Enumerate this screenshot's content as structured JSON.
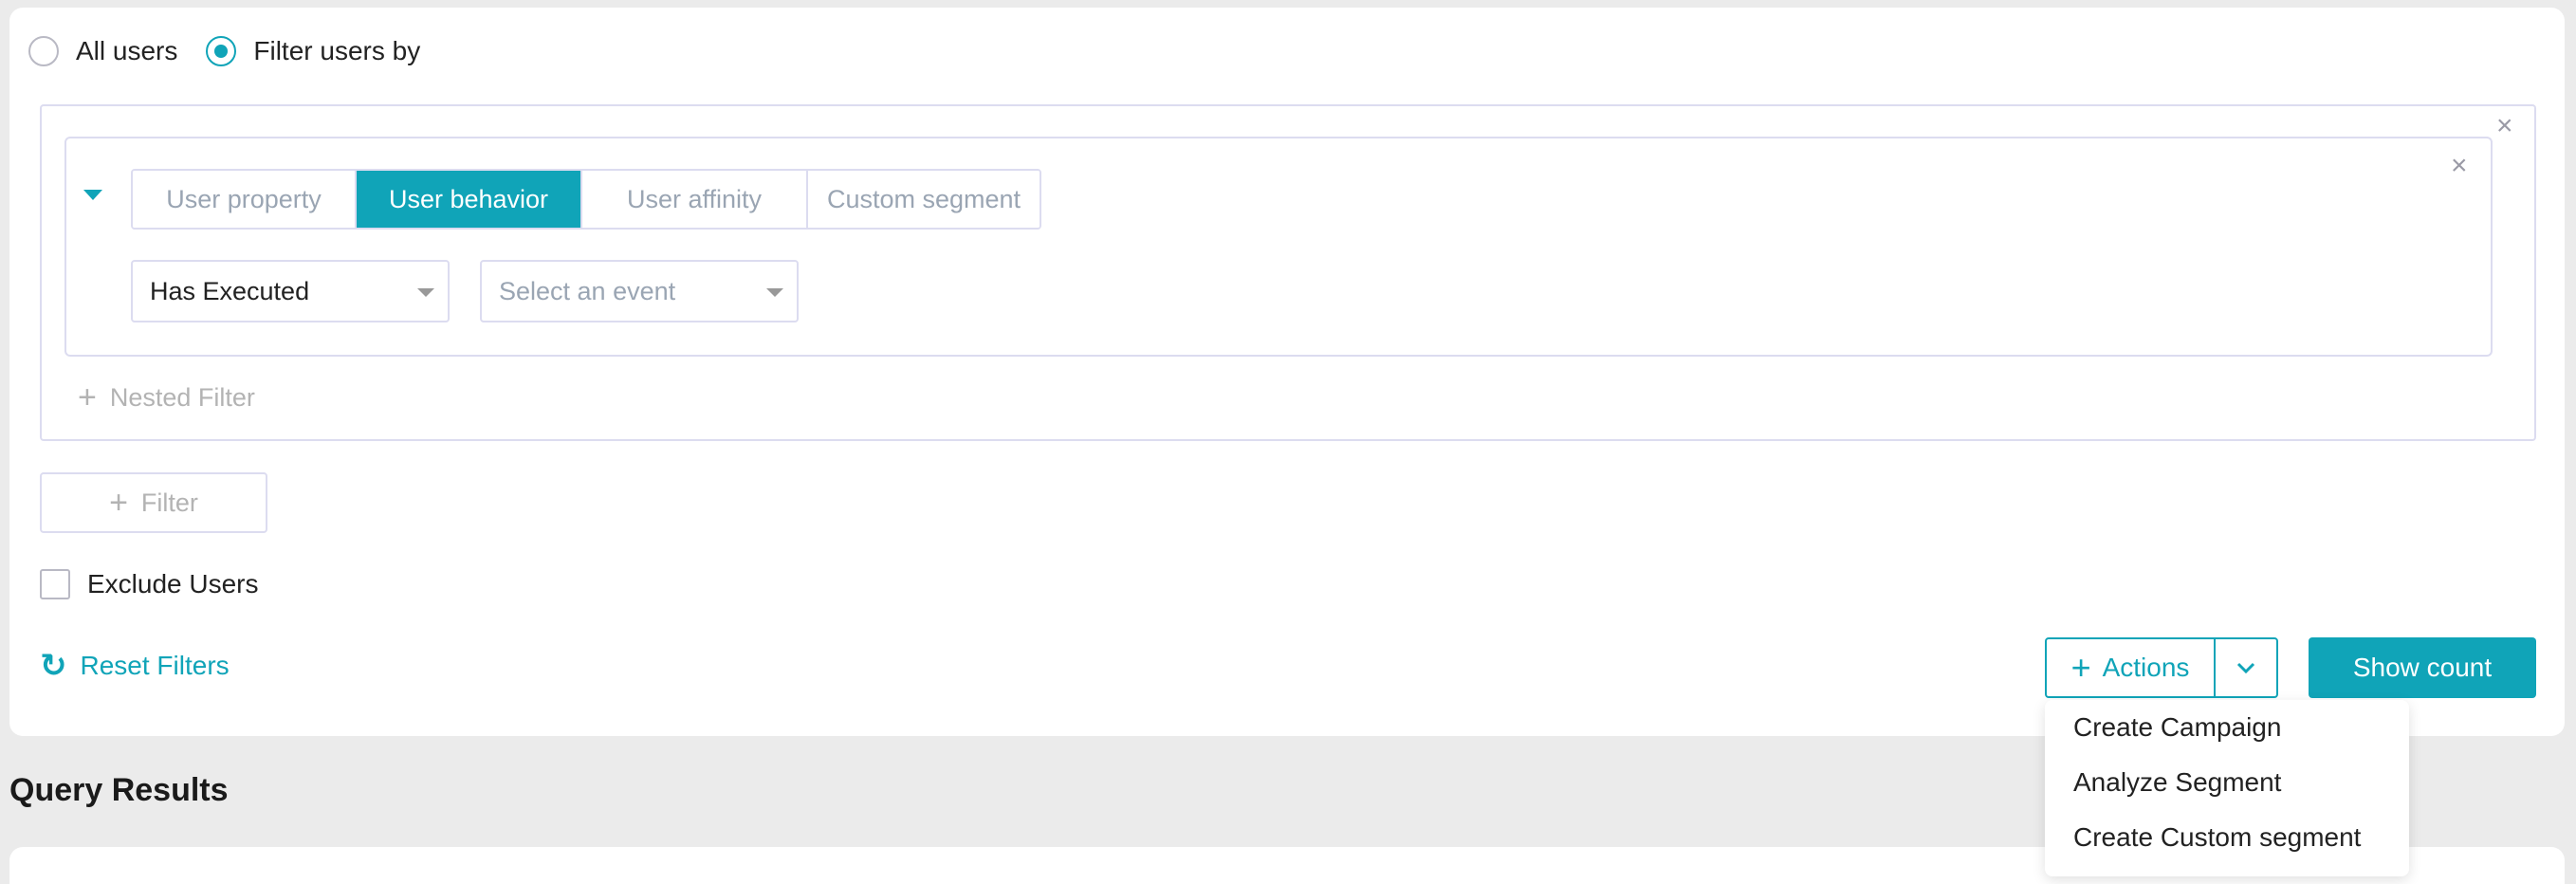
{
  "filter_mode": {
    "options": [
      {
        "label": "All users",
        "selected": false
      },
      {
        "label": "Filter users by",
        "selected": true
      }
    ]
  },
  "filter": {
    "tabs": [
      {
        "label": "User property",
        "active": false
      },
      {
        "label": "User behavior",
        "active": true
      },
      {
        "label": "User affinity",
        "active": false
      },
      {
        "label": "Custom segment",
        "active": false
      }
    ],
    "condition_select": {
      "value": "Has Executed"
    },
    "event_select": {
      "placeholder": "Select an event"
    },
    "nested_filter_label": "Nested Filter"
  },
  "add_filter_label": "Filter",
  "exclude_users": {
    "label": "Exclude Users",
    "checked": false
  },
  "reset_filters_label": "Reset Filters",
  "actions": {
    "label": "Actions",
    "menu_items": [
      "Create Campaign",
      "Analyze Segment",
      "Create Custom segment"
    ]
  },
  "show_count_label": "Show count",
  "query_results_title": "Query Results",
  "colors": {
    "accent": "#10a4b8",
    "border": "#dcdcf0",
    "muted": "#9aa5b3"
  }
}
